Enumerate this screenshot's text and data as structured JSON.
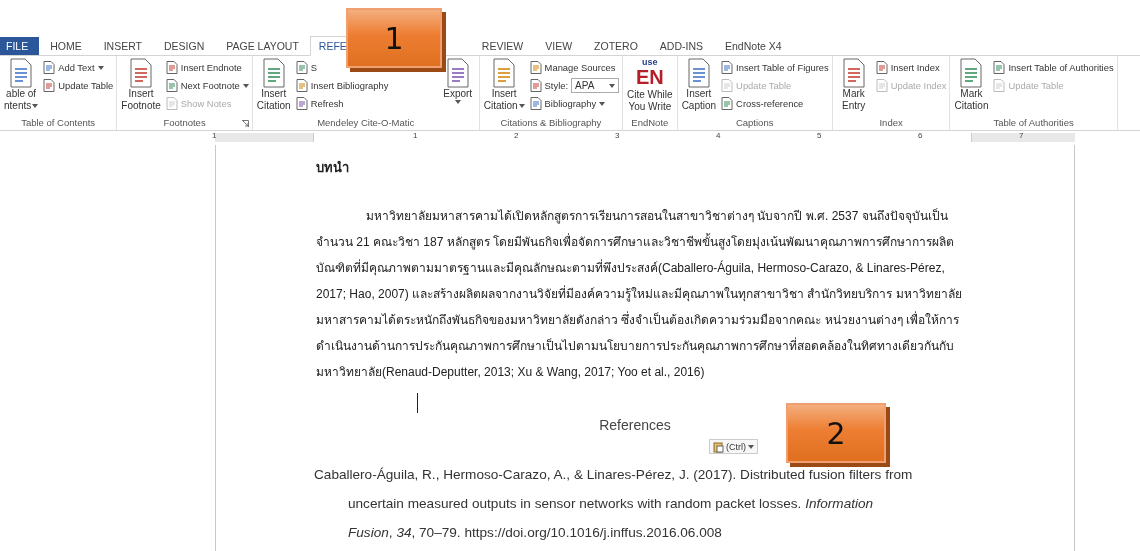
{
  "tabs": [
    {
      "label": "FILE",
      "kind": "file",
      "selected": false
    },
    {
      "label": "HOME",
      "kind": "tab",
      "selected": false
    },
    {
      "label": "INSERT",
      "kind": "tab",
      "selected": false
    },
    {
      "label": "DESIGN",
      "kind": "tab",
      "selected": false
    },
    {
      "label": "PAGE LAYOUT",
      "kind": "tab",
      "selected": false
    },
    {
      "label": "REFE",
      "kind": "tab",
      "selected": true
    },
    {
      "label": "REVIEW",
      "kind": "tab",
      "selected": false
    },
    {
      "label": "VIEW",
      "kind": "tab",
      "selected": false
    },
    {
      "label": "ZOTERO",
      "kind": "tab",
      "selected": false
    },
    {
      "label": "ADD-INS",
      "kind": "tab",
      "selected": false
    },
    {
      "label": "EndNote X4",
      "kind": "tab",
      "selected": false
    }
  ],
  "ribbon_groups": [
    {
      "label": "Table of Contents",
      "launcher": false,
      "items": [
        {
          "kind": "large",
          "lines": [
            "able of",
            "ntents"
          ],
          "dropdown": true
        },
        {
          "kind": "stack",
          "items": [
            {
              "kind": "button",
              "label": "Add Text",
              "dropdown": true,
              "disabled": false
            },
            {
              "kind": "button",
              "label": "Update Table",
              "dropdown": false,
              "disabled": false
            }
          ]
        }
      ]
    },
    {
      "label": "Footnotes",
      "launcher": true,
      "items": [
        {
          "kind": "large",
          "lines": [
            "Insert",
            "Footnote"
          ],
          "dropdown": false
        },
        {
          "kind": "stack",
          "items": [
            {
              "kind": "button",
              "label": "Insert Endnote",
              "dropdown": false,
              "disabled": false
            },
            {
              "kind": "button",
              "label": "Next Footnote",
              "dropdown": true,
              "disabled": false
            },
            {
              "kind": "button",
              "label": "Show Notes",
              "dropdown": false,
              "disabled": true
            }
          ]
        }
      ]
    },
    {
      "label": "Mendeley Cite-O-Matic",
      "launcher": false,
      "items": [
        {
          "kind": "large",
          "lines": [
            "Insert",
            "Citation"
          ],
          "dropdown": false
        },
        {
          "kind": "stack",
          "items": [
            {
              "kind": "button",
              "label": "S",
              "dropdown": false,
              "disabled": false
            },
            {
              "kind": "button",
              "label": "Insert Bibliography",
              "dropdown": false,
              "disabled": false
            },
            {
              "kind": "button",
              "label": "Refresh",
              "dropdown": false,
              "disabled": false
            }
          ]
        },
        {
          "kind": "large",
          "lines": [
            "Export"
          ],
          "dropdown": true
        }
      ]
    },
    {
      "label": "Citations & Bibliography",
      "launcher": false,
      "items": [
        {
          "kind": "large",
          "lines": [
            "Insert",
            "Citation"
          ],
          "dropdown": true
        },
        {
          "kind": "stack",
          "items": [
            {
              "kind": "button",
              "label": "Manage Sources",
              "dropdown": false,
              "disabled": false
            },
            {
              "kind": "select",
              "label": "Style:",
              "value": "APA"
            },
            {
              "kind": "button",
              "label": "Bibliography",
              "dropdown": true,
              "disabled": false
            }
          ]
        }
      ]
    },
    {
      "label": "EndNote",
      "launcher": false,
      "items": [
        {
          "kind": "logo",
          "logo_top": "use",
          "logo_main": "EN",
          "lines": [
            "Cite While",
            "You Write"
          ],
          "dropdown": false
        }
      ]
    },
    {
      "label": "Captions",
      "launcher": false,
      "items": [
        {
          "kind": "large",
          "lines": [
            "Insert",
            "Caption"
          ],
          "dropdown": false
        },
        {
          "kind": "stack",
          "items": [
            {
              "kind": "button",
              "label": "Insert Table of Figures",
              "dropdown": false,
              "disabled": false
            },
            {
              "kind": "button",
              "label": "Update Table",
              "dropdown": false,
              "disabled": true
            },
            {
              "kind": "button",
              "label": "Cross-reference",
              "dropdown": false,
              "disabled": false
            }
          ]
        }
      ]
    },
    {
      "label": "Index",
      "launcher": false,
      "items": [
        {
          "kind": "large",
          "lines": [
            "Mark",
            "Entry"
          ],
          "dropdown": false
        },
        {
          "kind": "stack",
          "items": [
            {
              "kind": "button",
              "label": "Insert Index",
              "dropdown": false,
              "disabled": false
            },
            {
              "kind": "button",
              "label": "Update Index",
              "dropdown": false,
              "disabled": true
            }
          ]
        }
      ]
    },
    {
      "label": "Table of Authorities",
      "launcher": false,
      "items": [
        {
          "kind": "large",
          "lines": [
            "Mark",
            "Citation"
          ],
          "dropdown": false
        },
        {
          "kind": "stack",
          "items": [
            {
              "kind": "button",
              "label": "Insert Table of Authorities",
              "dropdown": false,
              "disabled": false
            },
            {
              "kind": "button",
              "label": "Update Table",
              "dropdown": false,
              "disabled": true
            }
          ]
        }
      ]
    }
  ],
  "ruler": {
    "labels": [
      "1",
      "1",
      "2",
      "3",
      "4",
      "5",
      "6",
      "7"
    ]
  },
  "document": {
    "heading": "บทนำ",
    "paragraph_lines": [
      "มหาวิทยาลัยมหาสารคามได้เปิดหลักสูตรการเรียนการสอนในสาขาวิชาต่างๆ นับจากปี พ.ศ. 2537   จนถึงปัจจุบันเป็น",
      "จำนวน 21 คณะวิชา 187 หลักสูตร โดยมีพันธกิจเพื่อจัดการศึกษาและวิชาชีพขั้นสูงโดยมุ่งเน้นพัฒนาคุณภาพการศึกษาการผลิต",
      "บัณฑิตที่มีคุณภาพตามมาตรฐานและมีคุณลักษณะตามที่พึงประสงค์(Caballero-Águila, Hermoso-Carazo, & Linares-Pérez,",
      "2017; Hao, 2007) และสร้างผลิตผลจากงานวิจัยที่มีองค์ความรู้ใหม่และมีคุณภาพในทุกสาขาวิชา สำนักวิทยบริการ มหาวิทยาลัย",
      "มหาสารคามได้ตระหนักถึงพันธกิจของมหาวิทยาลัยดังกล่าว ซึ่งจำเป็นต้องเกิดความร่วมมือจากคณะ หน่วยงานต่างๆ เพื่อให้การ",
      "ดำเนินงานด้านการประกันคุณภาพการศึกษาเป็นไปตามนโยบายการประกันคุณภาพการศึกษาที่สอดคล้องในทิศทางเดียวกันกับ",
      "มหาวิทยาลัย(Renaud-Deputter, 2013; Xu & Wang, 2017; Yoo et al., 2016)"
    ],
    "references_heading": "References",
    "paste_options": "(Ctrl)",
    "reference_lines": [
      "Caballero-Águila, R., Hermoso-Carazo, A., & Linares-Pérez, J. (2017). Distributed fusion filters from",
      "uncertain measured outputs in sensor networks with random packet losses. *Information*",
      "*Fusion*, *34*, 70–79. https://doi.org/10.1016/j.inffus.2016.06.008"
    ]
  },
  "callouts": [
    {
      "label": "1"
    },
    {
      "label": "2"
    }
  ]
}
